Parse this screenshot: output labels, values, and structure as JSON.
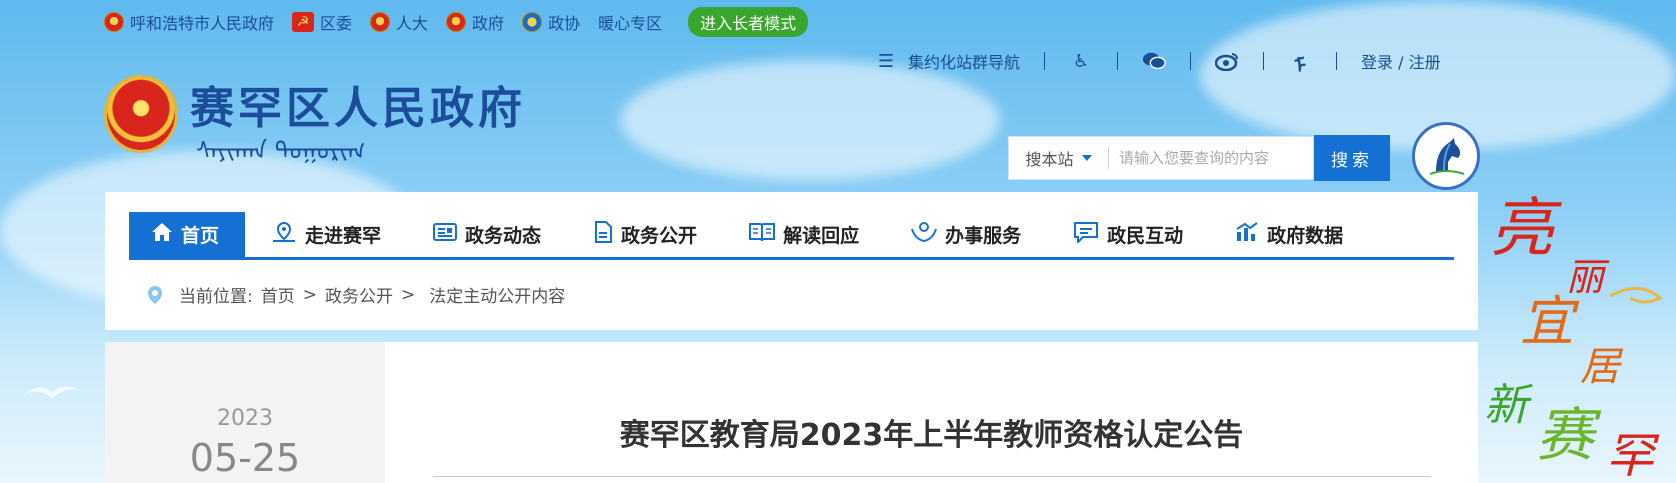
{
  "top_links": [
    {
      "label": "呼和浩特市人民政府",
      "icon": "emblem-icon"
    },
    {
      "label": "区委",
      "icon": "party-icon"
    },
    {
      "label": "人大",
      "icon": "emblem-icon"
    },
    {
      "label": "政府",
      "icon": "emblem-icon"
    },
    {
      "label": "政协",
      "icon": "cppcc-icon"
    },
    {
      "label": "暖心专区",
      "icon": ""
    }
  ],
  "elder_mode": "进入长者模式",
  "header_nav": {
    "site_group": "集约化站群导航",
    "login": "登录 / 注册"
  },
  "logo": {
    "title": "赛罕区人民政府",
    "subtitle_mongolian": "ᠰᠠᠶᠢᠬᠠᠨ ᠲᠣᠭᠣᠷᠢᠭ"
  },
  "search": {
    "scope": "搜本站",
    "placeholder": "请输入您要查询的内容",
    "button": "搜索"
  },
  "nav": [
    {
      "label": "首页",
      "icon": "home-icon",
      "active": true
    },
    {
      "label": "走进赛罕",
      "icon": "map-pin-icon"
    },
    {
      "label": "政务动态",
      "icon": "news-icon"
    },
    {
      "label": "政务公开",
      "icon": "document-icon"
    },
    {
      "label": "解读回应",
      "icon": "book-icon"
    },
    {
      "label": "办事服务",
      "icon": "hands-icon"
    },
    {
      "label": "政民互动",
      "icon": "chat-icon"
    },
    {
      "label": "政府数据",
      "icon": "bar-chart-icon"
    }
  ],
  "breadcrumb": {
    "prefix": "当前位置:",
    "items": [
      "首页",
      "政务公开",
      "法定主动公开内容"
    ]
  },
  "article": {
    "year": "2023",
    "date": "05-25",
    "title": "赛罕区教育局2023年上半年教师资格认定公告"
  },
  "slogan": "亮丽宜居新赛罕",
  "colors": {
    "accent": "#1570d4",
    "title": "#1b4d9b",
    "elder": "#3aa62d"
  }
}
